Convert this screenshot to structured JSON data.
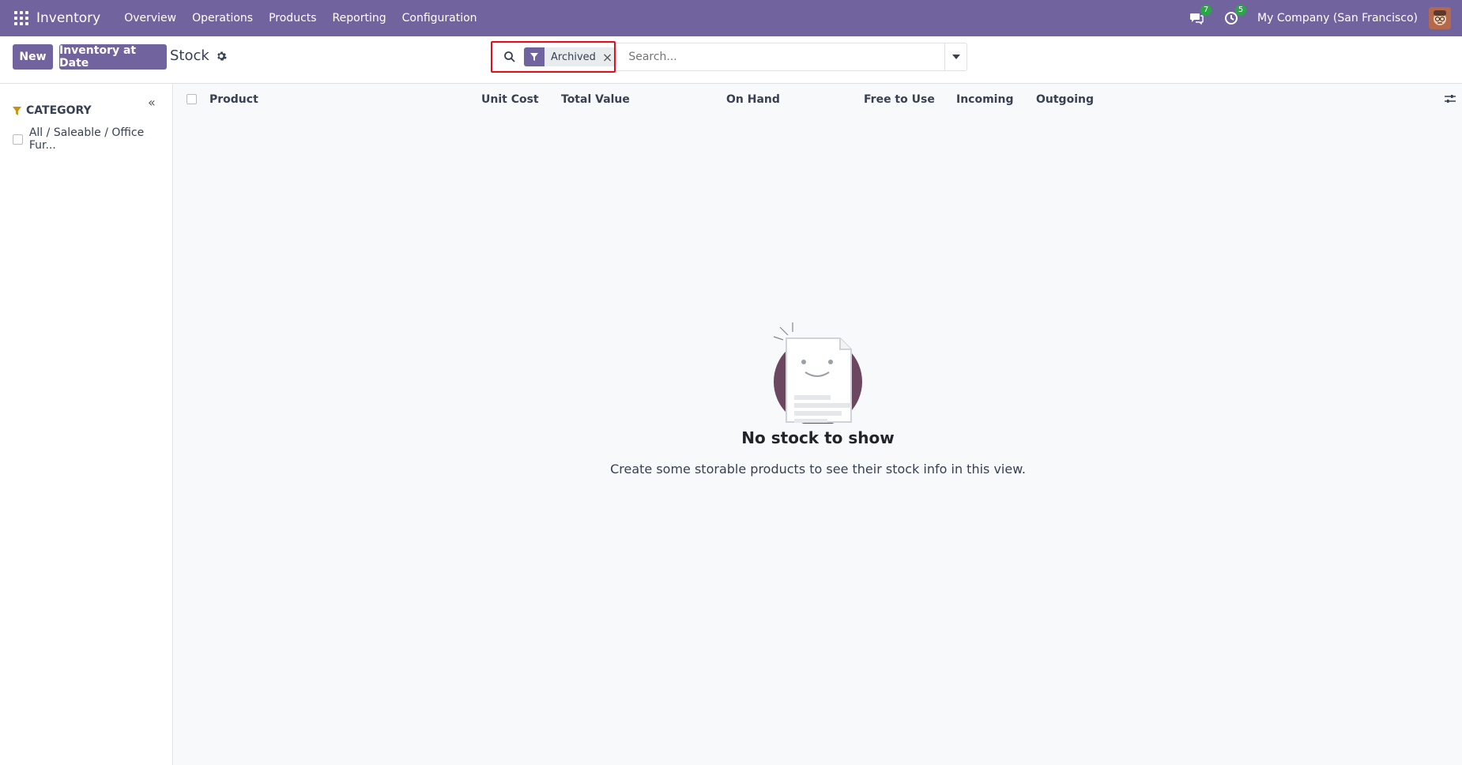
{
  "navbar": {
    "app_title": "Inventory",
    "menu": [
      "Overview",
      "Operations",
      "Products",
      "Reporting",
      "Configuration"
    ],
    "messages_count": "7",
    "activities_count": "5",
    "company": "My Company (San Francisco)"
  },
  "control": {
    "new_label": "New",
    "inventory_at_date_label": "Inventory at Date",
    "breadcrumb": "Stock",
    "facet_label": "Archived",
    "facet_close": "×",
    "search_placeholder": "Search..."
  },
  "sidebar": {
    "collapse_glyph": "«",
    "category_title": "CATEGORY",
    "items": [
      {
        "label": "All / Saleable / Office Fur..."
      }
    ]
  },
  "table": {
    "columns": [
      "Product",
      "Unit Cost",
      "Total Value",
      "On Hand",
      "Free to Use",
      "Incoming",
      "Outgoing"
    ]
  },
  "empty_state": {
    "title": "No stock to show",
    "text": "Create some storable products to see their stock info in this view."
  },
  "colors": {
    "brand": "#71639e",
    "highlight": "#e0101c",
    "badge": "#28a745"
  }
}
